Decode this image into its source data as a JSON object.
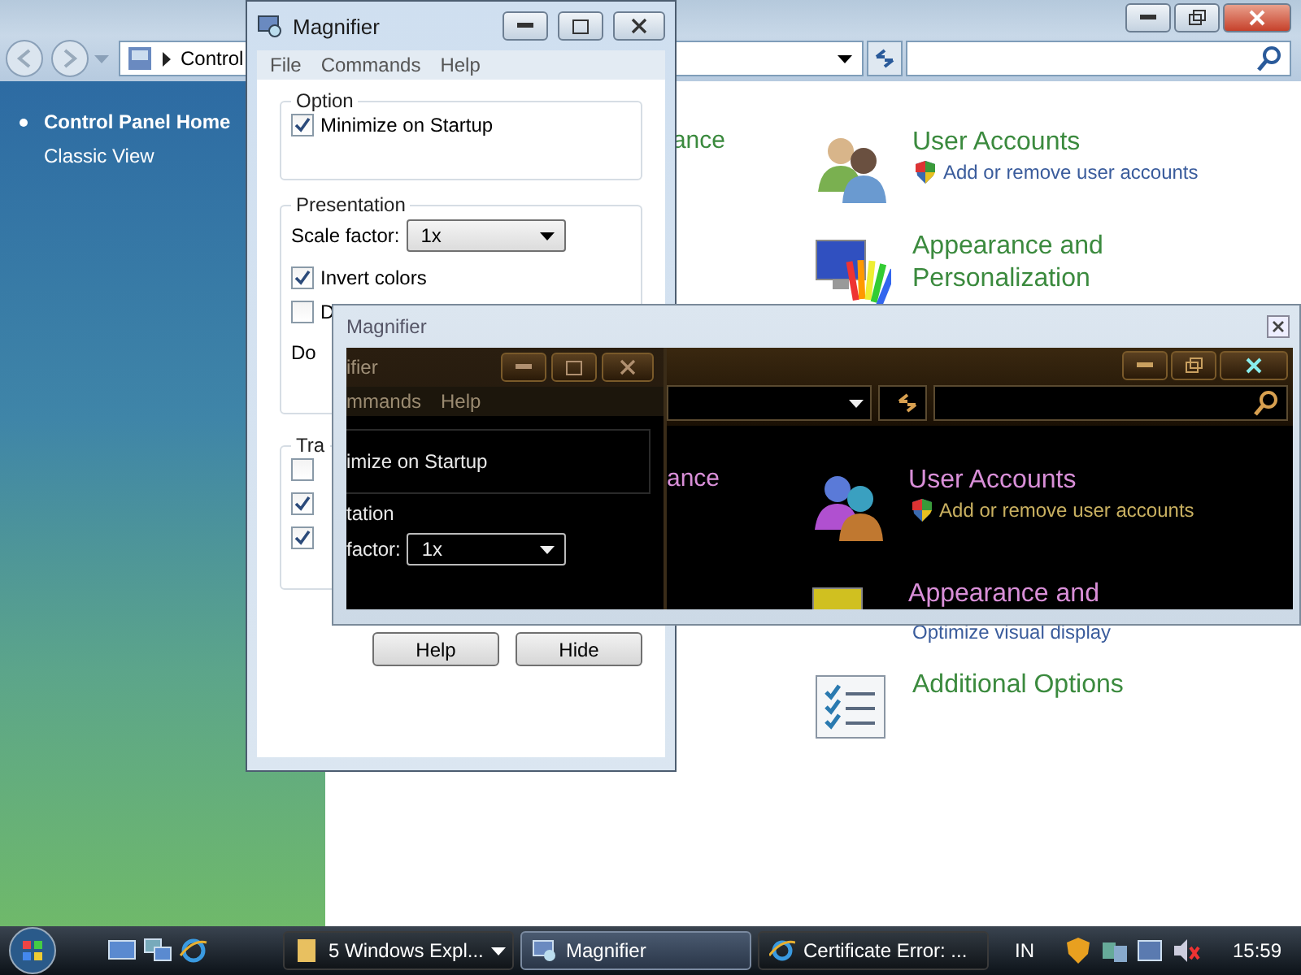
{
  "explorer": {
    "address": "Control",
    "sidebar": [
      {
        "label": "Control Panel Home",
        "selected": true
      },
      {
        "label": "Classic View",
        "selected": false
      }
    ],
    "partial_category": "ance",
    "categories": [
      {
        "kind": "users",
        "title": "User Accounts",
        "links": [
          {
            "text": "Add or remove user accounts",
            "shield": true
          }
        ]
      },
      {
        "kind": "appearance",
        "title": "Appearance and Personalization",
        "links": [
          {
            "text": "Optimize visual display",
            "shield": false
          }
        ]
      },
      {
        "kind": "options",
        "title": "Additional Options"
      }
    ]
  },
  "magnifier": {
    "title": "Magnifier",
    "menu": [
      "File",
      "Commands",
      "Help"
    ],
    "option_group": {
      "label": "Option",
      "checkboxes": [
        {
          "label": "Minimize on Startup",
          "checked": true
        }
      ]
    },
    "presentation_group": {
      "label": "Presentation",
      "scale_label": "Scale factor:",
      "scale_value": "1x",
      "checkboxes": [
        {
          "label": "Invert colors",
          "checked": true
        },
        {
          "label": "D",
          "checked": false
        }
      ],
      "dock_label": "Do"
    },
    "tracking_group": {
      "label": "Tra",
      "checkboxes": [
        {
          "checked": false
        },
        {
          "checked": true
        },
        {
          "checked": true
        }
      ]
    },
    "buttons": [
      "Help",
      "Hide"
    ]
  },
  "dock": {
    "title": "Magnifier",
    "inner_window": {
      "title": "ifier",
      "menu": [
        "mmands",
        "Help"
      ],
      "option_text": "imize on Startup",
      "group_label": "tation",
      "scale_label": "factor:",
      "scale_value": "1x"
    },
    "partial_category": "ance",
    "categories": [
      {
        "title": "User Accounts",
        "link": "Add or remove user accounts"
      },
      {
        "title": "Appearance and"
      }
    ]
  },
  "taskbar": {
    "tasks": [
      {
        "kind": "folder",
        "label": "5 Windows Expl...",
        "selected": false
      },
      {
        "kind": "magnifier",
        "label": "Magnifier",
        "selected": true
      },
      {
        "kind": "browser",
        "label": "Certificate Error: ...",
        "selected": false
      }
    ],
    "language": "IN",
    "clock": "15:59"
  }
}
